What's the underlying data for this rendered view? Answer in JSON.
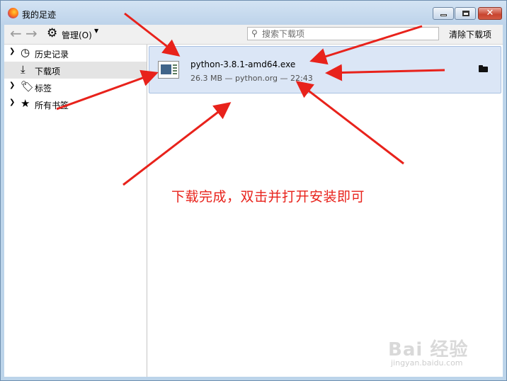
{
  "window": {
    "title": "我的足迹"
  },
  "toolbar": {
    "organize_label": "管理(O)",
    "search_placeholder": "搜索下载项",
    "clear_label": "清除下载项"
  },
  "sidebar": {
    "items": [
      {
        "label": "历史记录",
        "icon": "clock-icon",
        "expandable": true
      },
      {
        "label": "下载项",
        "icon": "download-icon",
        "expandable": false,
        "selected": true
      },
      {
        "label": "标签",
        "icon": "tag-icon",
        "expandable": true
      },
      {
        "label": "所有书签",
        "icon": "star-icon",
        "expandable": true
      }
    ]
  },
  "downloads": [
    {
      "filename": "python-3.8.1-amd64.exe",
      "meta": "26.3 MB — python.org — 22:43"
    }
  ],
  "annotation": {
    "text": "下载完成，双击并打开安装即可",
    "color": "#e8221b"
  },
  "watermark": {
    "main": "Bai 经验",
    "sub": "jingyan.baidu.com"
  }
}
